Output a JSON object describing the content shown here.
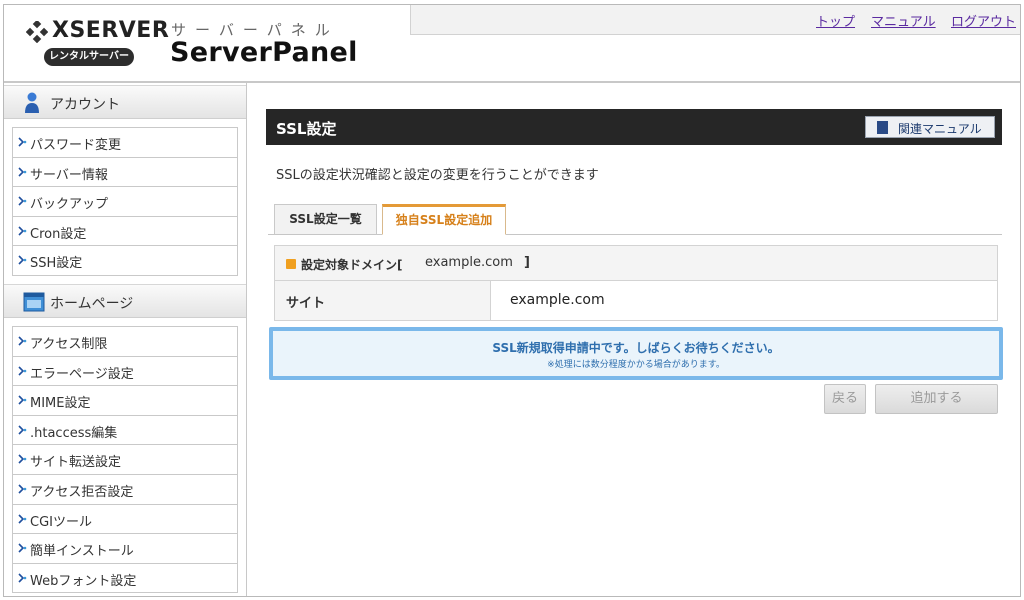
{
  "header": {
    "logo_text": "XSERVER",
    "badge": "レンタルサーバー",
    "panel_kana": "サーバーパネル",
    "panel_title": "ServerPanel",
    "links": [
      "トップ",
      "マニュアル",
      "ログアウト"
    ]
  },
  "sidebar": {
    "account": {
      "heading": "アカウント",
      "items": [
        "パスワード変更",
        "サーバー情報",
        "バックアップ",
        "Cron設定",
        "SSH設定"
      ]
    },
    "homepage": {
      "heading": "ホームページ",
      "items": [
        "アクセス制限",
        "エラーページ設定",
        "MIME設定",
        ".htaccess編集",
        "サイト転送設定",
        "アクセス拒否設定",
        "CGIツール",
        "簡単インストール",
        "Webフォント設定"
      ]
    }
  },
  "main": {
    "title": "SSL設定",
    "manual_button": "関連マニュアル",
    "description": "SSLの設定状況確認と設定の変更を行うことができます",
    "tabs": [
      "SSL設定一覧",
      "独自SSL設定追加"
    ],
    "domain_label": "設定対象ドメイン[",
    "domain_value": "example.com",
    "domain_close": "]",
    "site_label": "サイト",
    "site_value": "example.com",
    "notice_main": "SSL新規取得申請中です。しばらくお待ちください。",
    "notice_sub": "※処理には数分程度かかる場合があります。",
    "back_button": "戻る",
    "add_button": "追加する"
  }
}
